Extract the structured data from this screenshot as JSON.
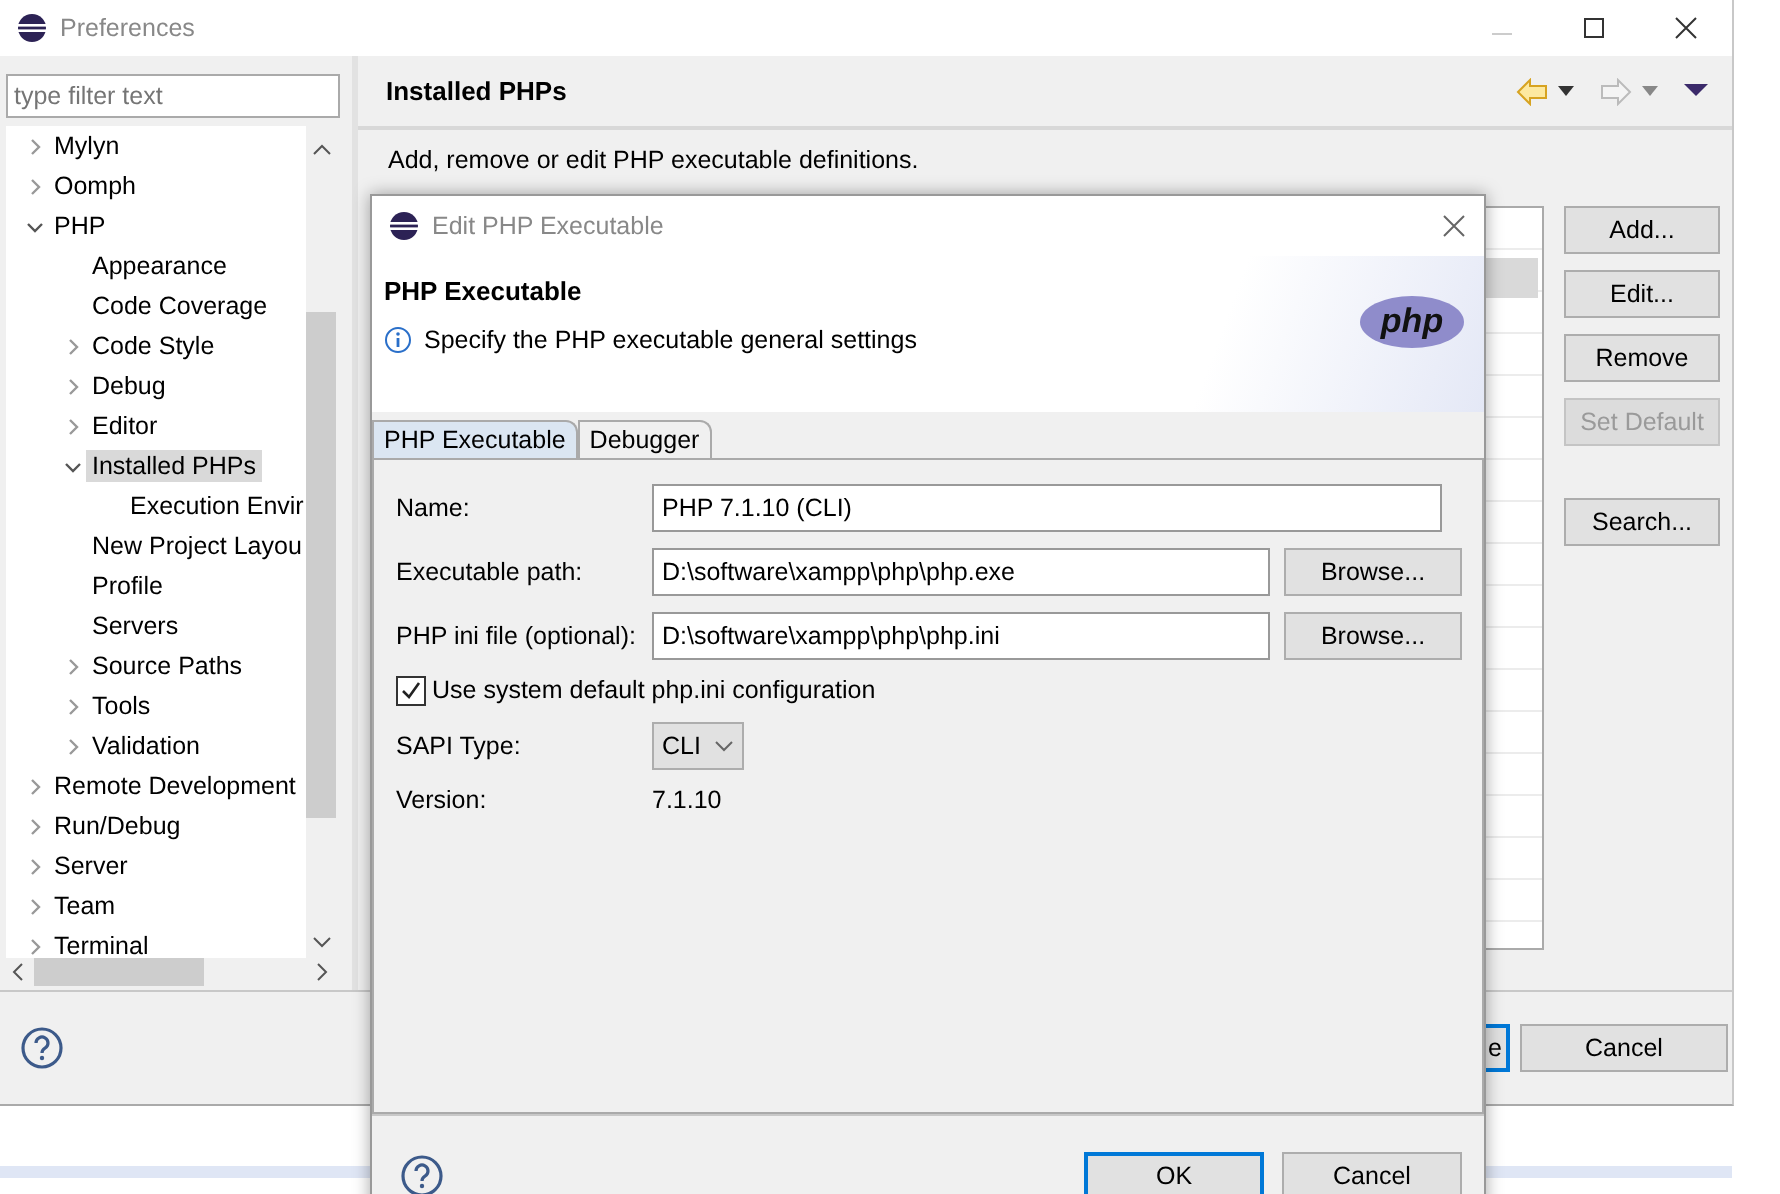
{
  "window": {
    "title": "Preferences"
  },
  "filter": {
    "placeholder": "type filter text"
  },
  "tree": [
    {
      "label": "Mylyn",
      "expanded": false,
      "selected": false
    },
    {
      "label": "Oomph",
      "expanded": false,
      "selected": false
    },
    {
      "label": "PHP",
      "expanded": true,
      "selected": false,
      "children": [
        {
          "label": "Appearance",
          "selected": false
        },
        {
          "label": "Code Coverage",
          "selected": false
        },
        {
          "label": "Code Style",
          "expanded": false,
          "selected": false
        },
        {
          "label": "Debug",
          "expanded": false,
          "selected": false
        },
        {
          "label": "Editor",
          "expanded": false,
          "selected": false
        },
        {
          "label": "Installed PHPs",
          "expanded": true,
          "selected": true,
          "children": [
            {
              "label": "Execution Envir",
              "selected": false
            }
          ]
        },
        {
          "label": "New Project Layou",
          "selected": false
        },
        {
          "label": "Profile",
          "selected": false
        },
        {
          "label": "Servers",
          "selected": false
        },
        {
          "label": "Source Paths",
          "expanded": false,
          "selected": false
        },
        {
          "label": "Tools",
          "expanded": false,
          "selected": false
        },
        {
          "label": "Validation",
          "expanded": false,
          "selected": false
        }
      ]
    },
    {
      "label": "Remote Development",
      "expanded": false,
      "selected": false
    },
    {
      "label": "Run/Debug",
      "expanded": false,
      "selected": false
    },
    {
      "label": "Server",
      "expanded": false,
      "selected": false
    },
    {
      "label": "Team",
      "expanded": false,
      "selected": false
    },
    {
      "label": "Terminal",
      "expanded": false,
      "selected": false
    }
  ],
  "page": {
    "title": "Installed PHPs",
    "description": "Add, remove or edit PHP executable definitions.",
    "buttons": [
      {
        "label": "Add...",
        "disabled": false
      },
      {
        "label": "Edit...",
        "disabled": false
      },
      {
        "label": "Remove",
        "disabled": false
      },
      {
        "label": "Set Default",
        "disabled": true
      },
      {
        "label": "Search...",
        "disabled": false
      }
    ]
  },
  "footer_buttons": [
    {
      "label": "e",
      "default": true
    },
    {
      "label": "Cancel",
      "default": false
    }
  ],
  "dialog": {
    "title": "Edit PHP Executable",
    "heading": "PHP Executable",
    "message": "Specify the PHP executable general settings",
    "logo": "php",
    "tabs": [
      {
        "label": "PHP Executable",
        "selected": true
      },
      {
        "label": "Debugger",
        "selected": false
      }
    ],
    "fields": [
      {
        "kind": "text",
        "label": "Name:",
        "value": "PHP 7.1.10 (CLI)"
      },
      {
        "kind": "file",
        "label": "Executable path:",
        "value": "D:\\software\\xampp\\php\\php.exe",
        "button": "Browse..."
      },
      {
        "kind": "file",
        "label": "PHP ini file (optional):",
        "value": "D:\\software\\xampp\\php\\php.ini",
        "button": "Browse..."
      },
      {
        "kind": "checkbox",
        "label": "Use system default php.ini configuration",
        "checked": true
      },
      {
        "kind": "select",
        "label": "SAPI Type:",
        "value": "CLI"
      },
      {
        "kind": "info",
        "label": "Version:",
        "value": "7.1.10"
      }
    ],
    "buttons": [
      {
        "label": "OK",
        "default": true
      },
      {
        "label": "Cancel",
        "default": false
      }
    ]
  }
}
